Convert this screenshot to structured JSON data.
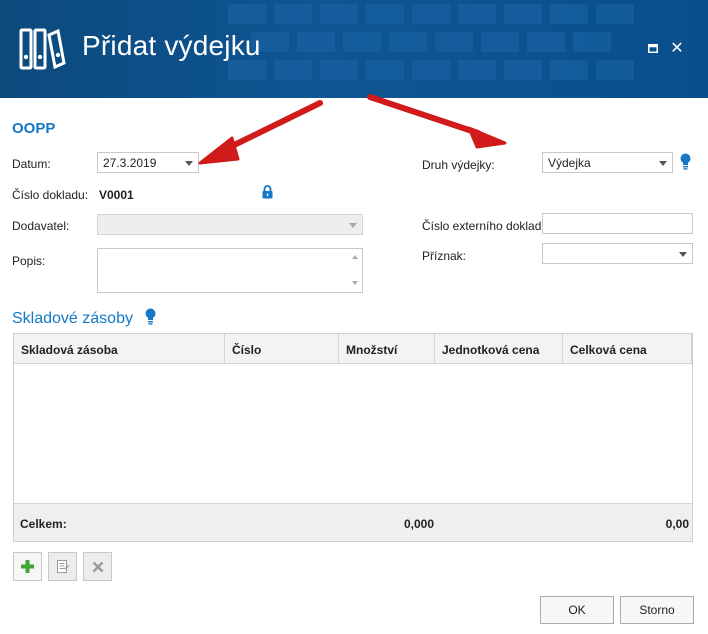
{
  "window": {
    "title": "Přidat výdejku",
    "maximize_label": "",
    "close_label": "✕"
  },
  "section": {
    "title": "OOPP"
  },
  "form": {
    "datum_label": "Datum:",
    "datum_value": "27.3.2019",
    "cislo_dokladu_label": "Číslo dokladu:",
    "cislo_dokladu_value": "V0001",
    "dodavatel_label": "Dodavatel:",
    "dodavatel_value": "",
    "popis_label": "Popis:",
    "popis_value": "",
    "druh_vydejky_label": "Druh výdejky:",
    "druh_vydejky_value": "Výdejka",
    "cislo_externiho_label": "Číslo externího dokladu:",
    "cislo_externiho_value": "",
    "priznak_label": "Příznak:",
    "priznak_value": ""
  },
  "grid": {
    "title": "Skladové zásoby",
    "columns": [
      "Skladová zásoba",
      "Číslo",
      "Množství",
      "Jednotková cena",
      "Celková cena"
    ],
    "rows": [],
    "footer": {
      "label": "Celkem:",
      "quantity_total": "0,000",
      "price_total": "0,00"
    }
  },
  "buttons": {
    "ok": "OK",
    "cancel": "Storno"
  },
  "colors": {
    "title_bar": "#0e5592",
    "accent": "#1578c5",
    "arrow": "#d11b1b",
    "add_icon": "#3fa535"
  },
  "icons": {
    "app": "binders-icon",
    "lock": "lock-icon",
    "hint": "lightbulb-icon",
    "add": "plus-icon",
    "edit": "document-icon",
    "delete": "x-icon"
  }
}
